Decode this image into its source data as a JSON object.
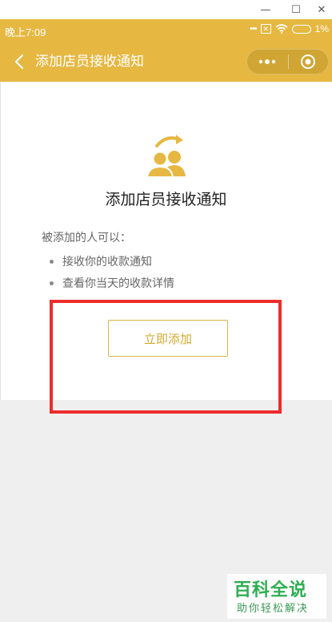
{
  "window": {
    "minimize_glyph": "—",
    "maximize_glyph": "☐",
    "close_glyph": "✕"
  },
  "status_bar": {
    "time": "晚上7:09",
    "battery": "1%",
    "icons": [
      "signal-icon",
      "no-sim-icon",
      "wifi-icon",
      "battery-icon"
    ]
  },
  "nav": {
    "title": "添加店员接收通知",
    "back_icon": "chevron-left-icon",
    "more_icon": "more-dots-icon",
    "close_icon": "target-circle-icon"
  },
  "hero": {
    "icon": "staff-users-icon",
    "title": "添加店员接收通知"
  },
  "permissions": {
    "intro": "被添加的人可以：",
    "items": [
      "接收你的收款通知",
      "查看你当天的收款详情"
    ]
  },
  "actions": {
    "add_label": "立即添加"
  },
  "watermark": {
    "brand": "百科全说",
    "slogan": "助你轻松解决"
  },
  "colors": {
    "brand": "#e6b842",
    "button_text": "#d4a92e",
    "highlight": "#ee2c2c",
    "lower_bg": "#efefef",
    "watermark": "#2fae52"
  }
}
